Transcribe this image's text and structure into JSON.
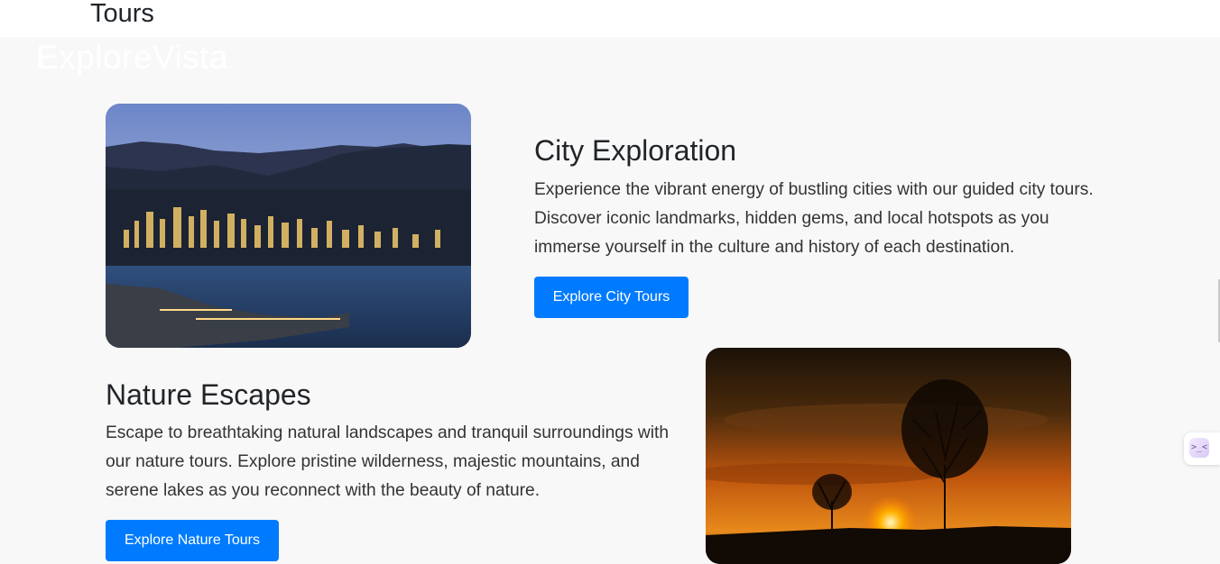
{
  "header": {
    "page_heading": "Tours",
    "brand": "ExploreVista"
  },
  "sections": {
    "city": {
      "title": "City Exploration",
      "description": "Experience the vibrant energy of bustling cities with our guided city tours. Discover iconic landmarks, hidden gems, and local hotspots as you immerse yourself in the culture and history of each destination.",
      "button_label": "Explore City Tours"
    },
    "nature": {
      "title": "Nature Escapes",
      "description": "Escape to breathtaking natural landscapes and tranquil surroundings with our nature tours. Explore pristine wilderness, majestic mountains, and serene lakes as you reconnect with the beauty of nature.",
      "button_label": "Explore Nature Tours"
    }
  },
  "widget": {
    "icon": "assistant-face-icon",
    "glyph": ">_<"
  },
  "colors": {
    "accent": "#007bff",
    "background": "#f8f8f8",
    "header_bg": "#ffffff"
  }
}
